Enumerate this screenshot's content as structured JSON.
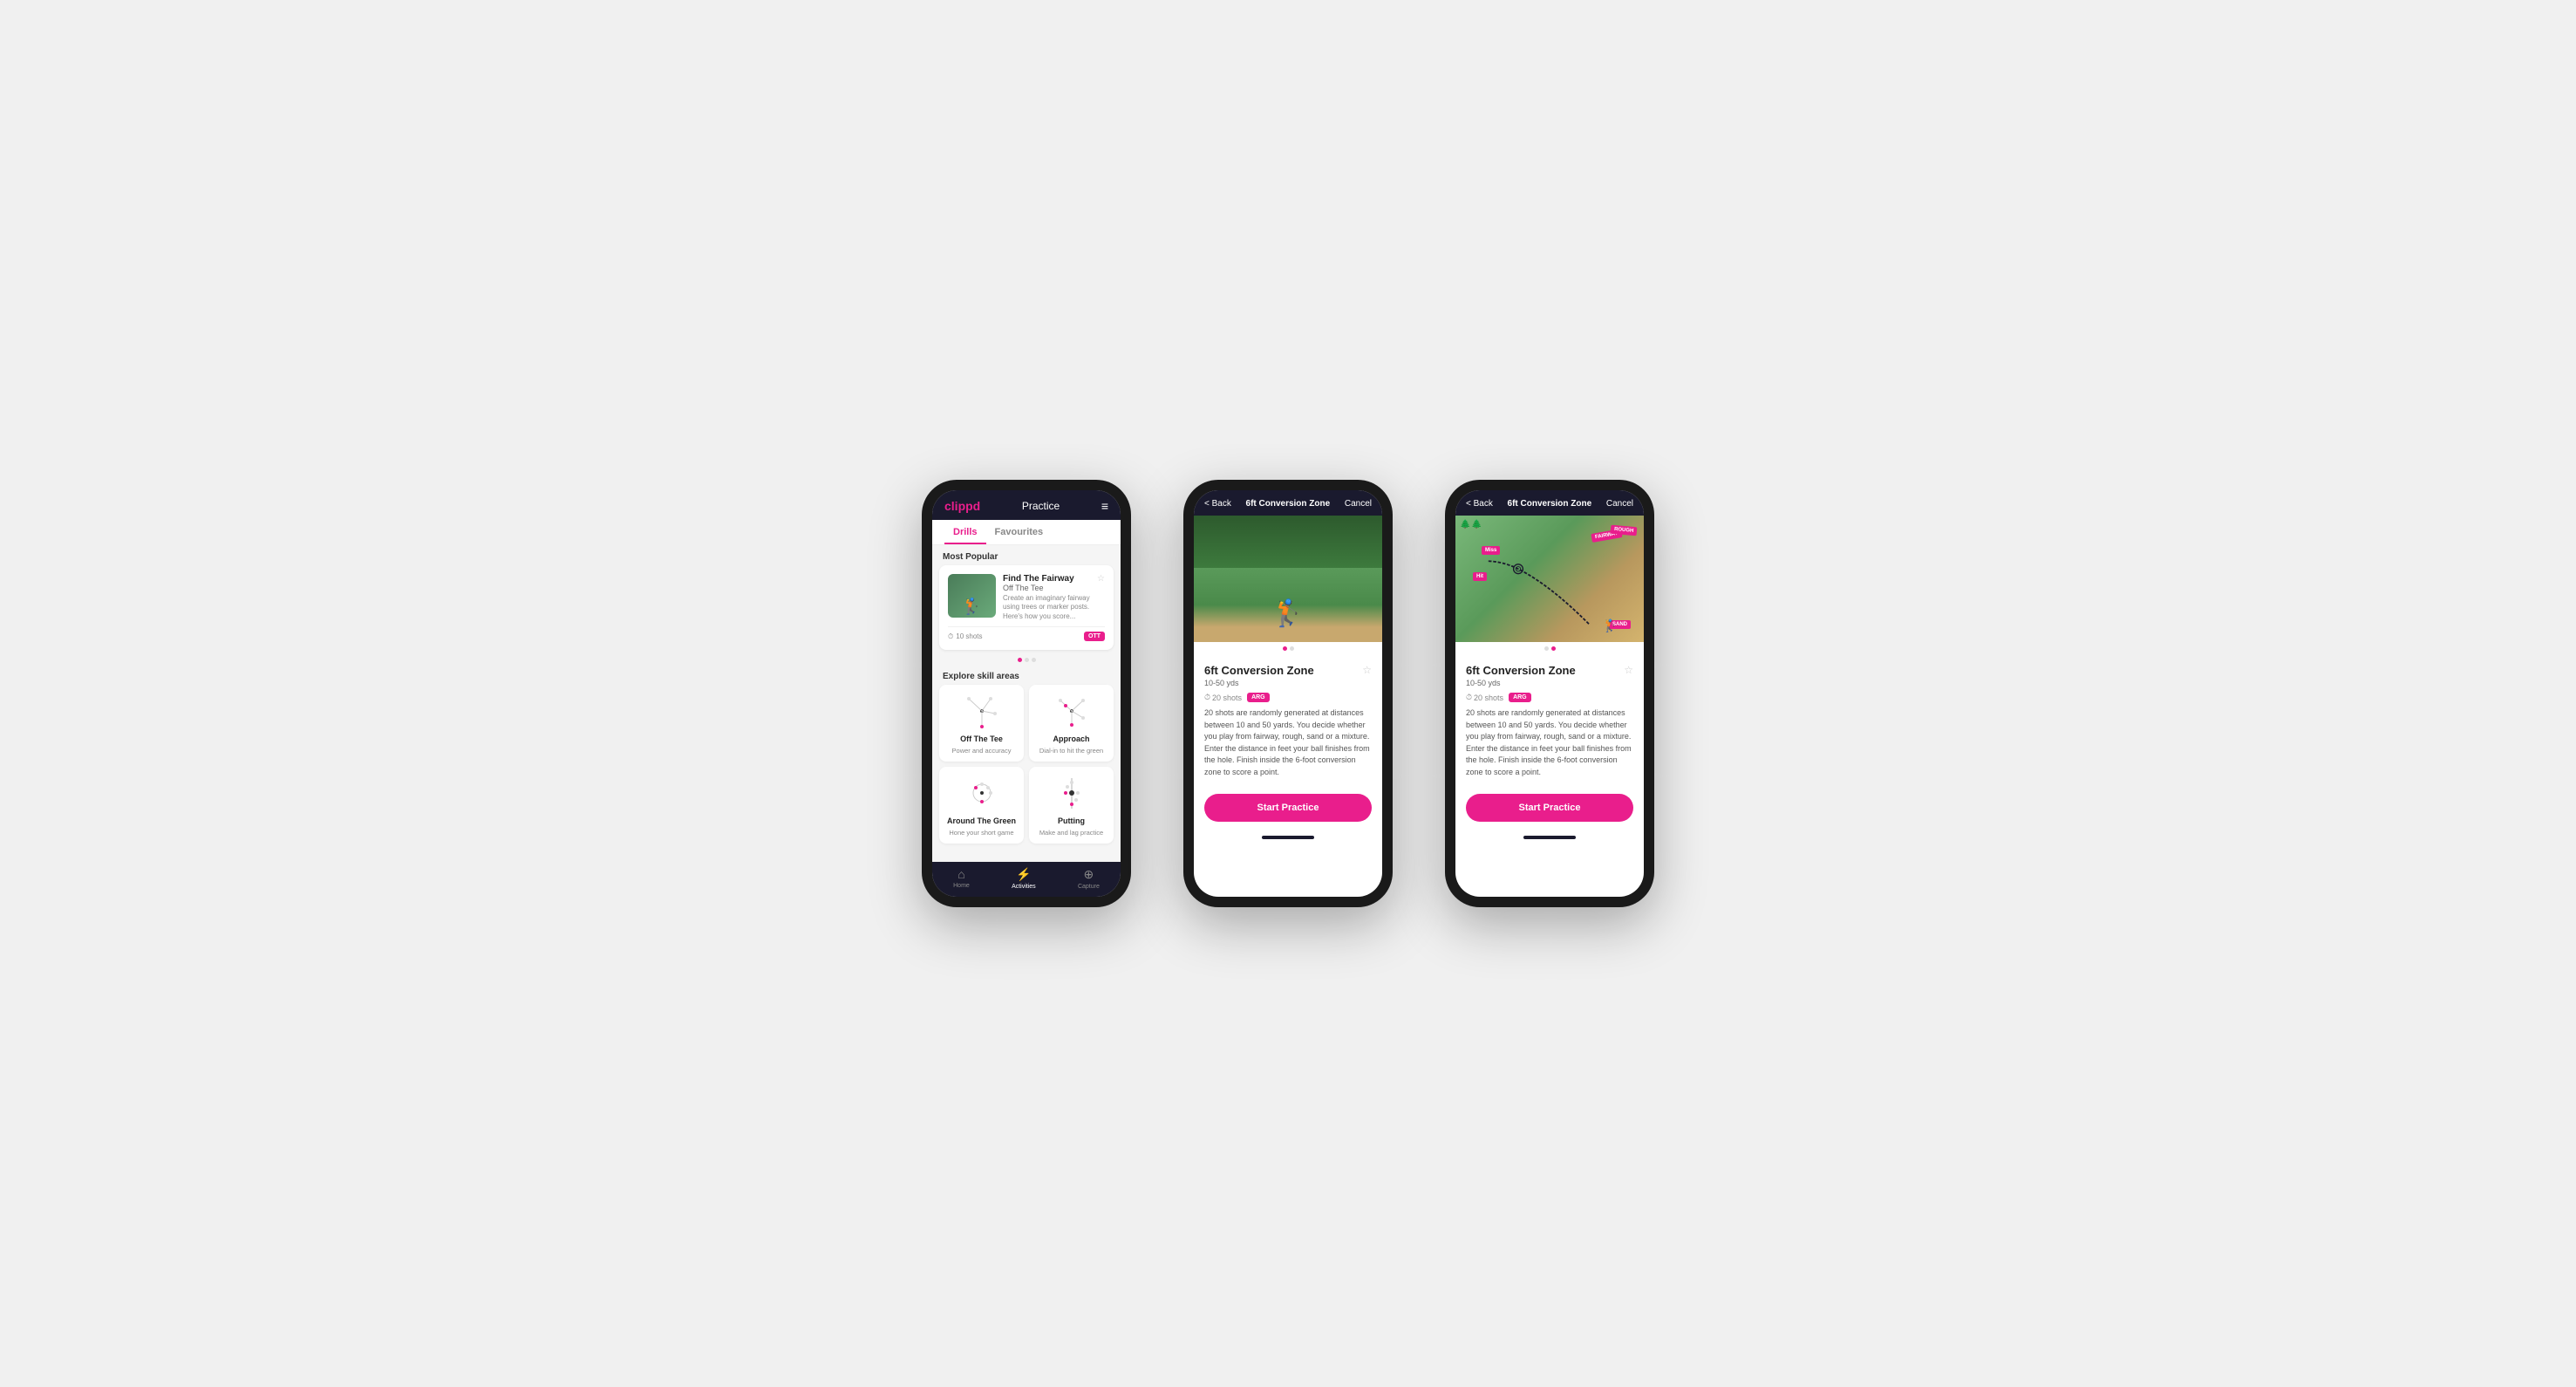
{
  "phones": {
    "phone1": {
      "header": {
        "logo": "clippd",
        "title": "Practice",
        "menu_icon": "≡"
      },
      "tabs": [
        {
          "label": "Drills",
          "active": true
        },
        {
          "label": "Favourites",
          "active": false
        }
      ],
      "most_popular_label": "Most Popular",
      "featured_drill": {
        "title": "Find The Fairway",
        "subtitle": "Off The Tee",
        "description": "Create an imaginary fairway using trees or marker posts. Here's how you score...",
        "shots": "10 shots",
        "badge": "OTT",
        "star_icon": "☆"
      },
      "explore_label": "Explore skill areas",
      "skill_areas": [
        {
          "label": "Off The Tee",
          "sub": "Power and accuracy"
        },
        {
          "label": "Approach",
          "sub": "Dial-in to hit the green"
        },
        {
          "label": "Around The Green",
          "sub": "Hone your short game"
        },
        {
          "label": "Putting",
          "sub": "Make and lag practice"
        }
      ],
      "bottom_nav": [
        {
          "label": "Home",
          "icon": "⌂",
          "active": false
        },
        {
          "label": "Activities",
          "icon": "⚡",
          "active": true
        },
        {
          "label": "Capture",
          "icon": "⊕",
          "active": false
        }
      ]
    },
    "phone2": {
      "header": {
        "back_label": "< Back",
        "title": "6ft Conversion Zone",
        "cancel_label": "Cancel"
      },
      "drill_title": "6ft Conversion Zone",
      "drill_range": "10-50 yds",
      "shots_label": "20 shots",
      "badge": "ARG",
      "description": "20 shots are randomly generated at distances between 10 and 50 yards. You decide whether you play from fairway, rough, sand or a mixture. Enter the distance in feet your ball finishes from the hole. Finish inside the 6-foot conversion zone to score a point.",
      "start_button": "Start Practice",
      "image_type": "photo"
    },
    "phone3": {
      "header": {
        "back_label": "< Back",
        "title": "6ft Conversion Zone",
        "cancel_label": "Cancel"
      },
      "drill_title": "6ft Conversion Zone",
      "drill_range": "10-50 yds",
      "shots_label": "20 shots",
      "badge": "ARG",
      "description": "20 shots are randomly generated at distances between 10 and 50 yards. You decide whether you play from fairway, rough, sand or a mixture. Enter the distance in feet your ball finishes from the hole. Finish inside the 6-foot conversion zone to score a point.",
      "start_button": "Start Practice",
      "image_type": "map",
      "map_labels": [
        "Miss",
        "Hit",
        "FAIRWAY",
        "ROUGH",
        "SAND"
      ]
    }
  }
}
